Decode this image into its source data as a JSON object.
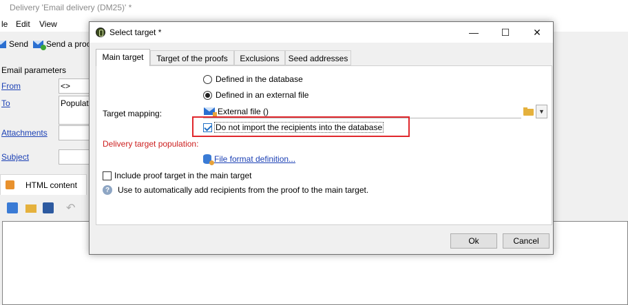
{
  "app": {
    "title": "Delivery 'Email delivery (DM25)' *",
    "menu": [
      "le",
      "Edit",
      "View"
    ],
    "toolbar": {
      "send_label": "Send",
      "send_proof_label": "Send a proo"
    },
    "email_params": {
      "section_label": "Email parameters",
      "from_label": "From",
      "from_value": "<>",
      "to_label": "To",
      "to_value": "Populati",
      "attachments_label": "Attachments",
      "subject_label": "Subject"
    },
    "content_tab_label": "HTML content"
  },
  "dialog": {
    "title": "Select target *",
    "window_controls": {
      "minimize": "—",
      "maximize": "☐",
      "close": "✕"
    },
    "tabs": [
      {
        "label": "Main target",
        "active": true
      },
      {
        "label": "Target of the proofs",
        "active": false
      },
      {
        "label": "Exclusions",
        "active": false
      },
      {
        "label": "Seed addresses",
        "active": false
      }
    ],
    "options": {
      "defined_in_db": "Defined in the database",
      "defined_in_file": "Defined in an external file",
      "selected": "defined_in_file"
    },
    "target_mapping_label": "Target mapping:",
    "target_mapping_value": "External file ()",
    "no_import_label": "Do not import the recipients into the database",
    "no_import_checked": true,
    "delivery_population_label": "Delivery target population:",
    "file_format_link": "File format definition...",
    "include_proof_label": "Include proof target in the main target",
    "include_proof_checked": false,
    "info_text": "Use to automatically add recipients from the proof to the main target.",
    "ok_label": "Ok",
    "cancel_label": "Cancel"
  },
  "colors": {
    "highlight": "#e0262b",
    "link": "#1a3fb4",
    "population_label": "#cc1e1e"
  }
}
